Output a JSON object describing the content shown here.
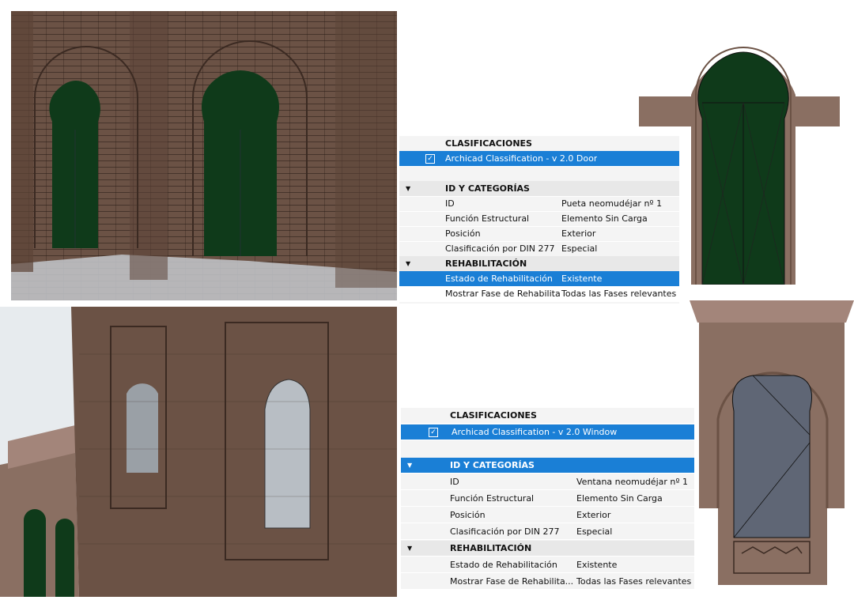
{
  "panel_door": {
    "section_classifications": "CLASIFICACIONES",
    "classification_label": "Archicad Classification - v 2.0 Door",
    "section_id": "ID Y CATEGORÍAS",
    "rows": [
      {
        "label": "ID",
        "value": "Pueta neomudéjar nº 1"
      },
      {
        "label": "Función Estructural",
        "value": "Elemento Sin Carga"
      },
      {
        "label": "Posición",
        "value": "Exterior"
      },
      {
        "label": "Clasificación por DIN 277",
        "value": "Especial"
      }
    ],
    "section_rehab": "REHABILITACIÓN",
    "rehab_rows": [
      {
        "label": "Estado de Rehabilitación",
        "value": "Existente"
      },
      {
        "label": "Mostrar Fase de Rehabilita...",
        "value": "Todas las Fases relevantes"
      }
    ]
  },
  "panel_window": {
    "section_classifications": "CLASIFICACIONES",
    "classification_label": "Archicad Classification - v 2.0 Window",
    "section_id": "ID Y CATEGORÍAS",
    "rows": [
      {
        "label": "ID",
        "value": "Ventana neomudéjar nº 1"
      },
      {
        "label": "Función Estructural",
        "value": "Elemento Sin Carga"
      },
      {
        "label": "Posición",
        "value": "Exterior"
      },
      {
        "label": "Clasificación por DIN 277",
        "value": "Especial"
      }
    ],
    "section_rehab": "REHABILITACIÓN",
    "rehab_rows": [
      {
        "label": "Estado de Rehabilitación",
        "value": "Existente"
      },
      {
        "label": "Mostrar Fase de Rehabilita...",
        "value": "Todas las Fases relevantes"
      }
    ]
  },
  "colors": {
    "selection": "#1a7fd6",
    "door_green": "#0f3a1a",
    "glass": "#5f6675"
  },
  "icons": {
    "checkbox": "checkbox-checked-icon",
    "expand": "triangle-down-icon"
  }
}
